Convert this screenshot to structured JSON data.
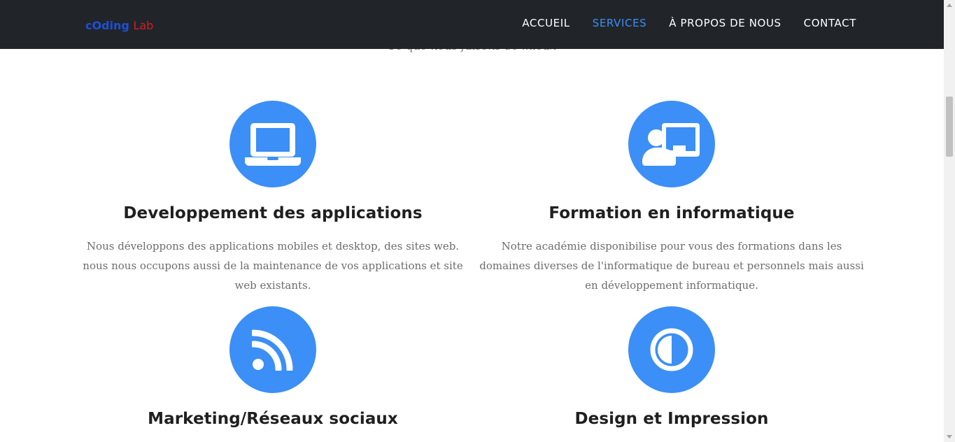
{
  "navbar": {
    "logo_part1": "cOding",
    "logo_part2": "Lab",
    "items": [
      {
        "label": "ACCUEIL",
        "active": false
      },
      {
        "label": "SERVICES",
        "active": true
      },
      {
        "label": "À PROPOS DE NOUS",
        "active": false
      },
      {
        "label": "CONTACT",
        "active": false
      }
    ]
  },
  "section": {
    "subtitle": "Ce que nous faisons de mieux"
  },
  "services": [
    {
      "icon": "laptop-icon",
      "title": "Developpement des applications",
      "description": "Nous développons des applications mobiles et desktop, des sites web. nous nous occupons aussi de la maintenance de vos applications et site web existants."
    },
    {
      "icon": "chalkboard-teacher-icon",
      "title": "Formation en informatique",
      "description": "Notre académie disponibilise pour vous des formations dans les domaines diverses de l'informatique de bureau et personnels mais aussi en développement informatique."
    },
    {
      "icon": "rss-icon",
      "title": "Marketing/Réseaux sociaux",
      "description": ""
    },
    {
      "icon": "adjust-icon",
      "title": "Design et Impression",
      "description": ""
    }
  ],
  "colors": {
    "accent": "#3b8ff6",
    "navbar_bg": "#212529",
    "heading": "#1f1f1f",
    "body_text": "#6d6d6d"
  }
}
